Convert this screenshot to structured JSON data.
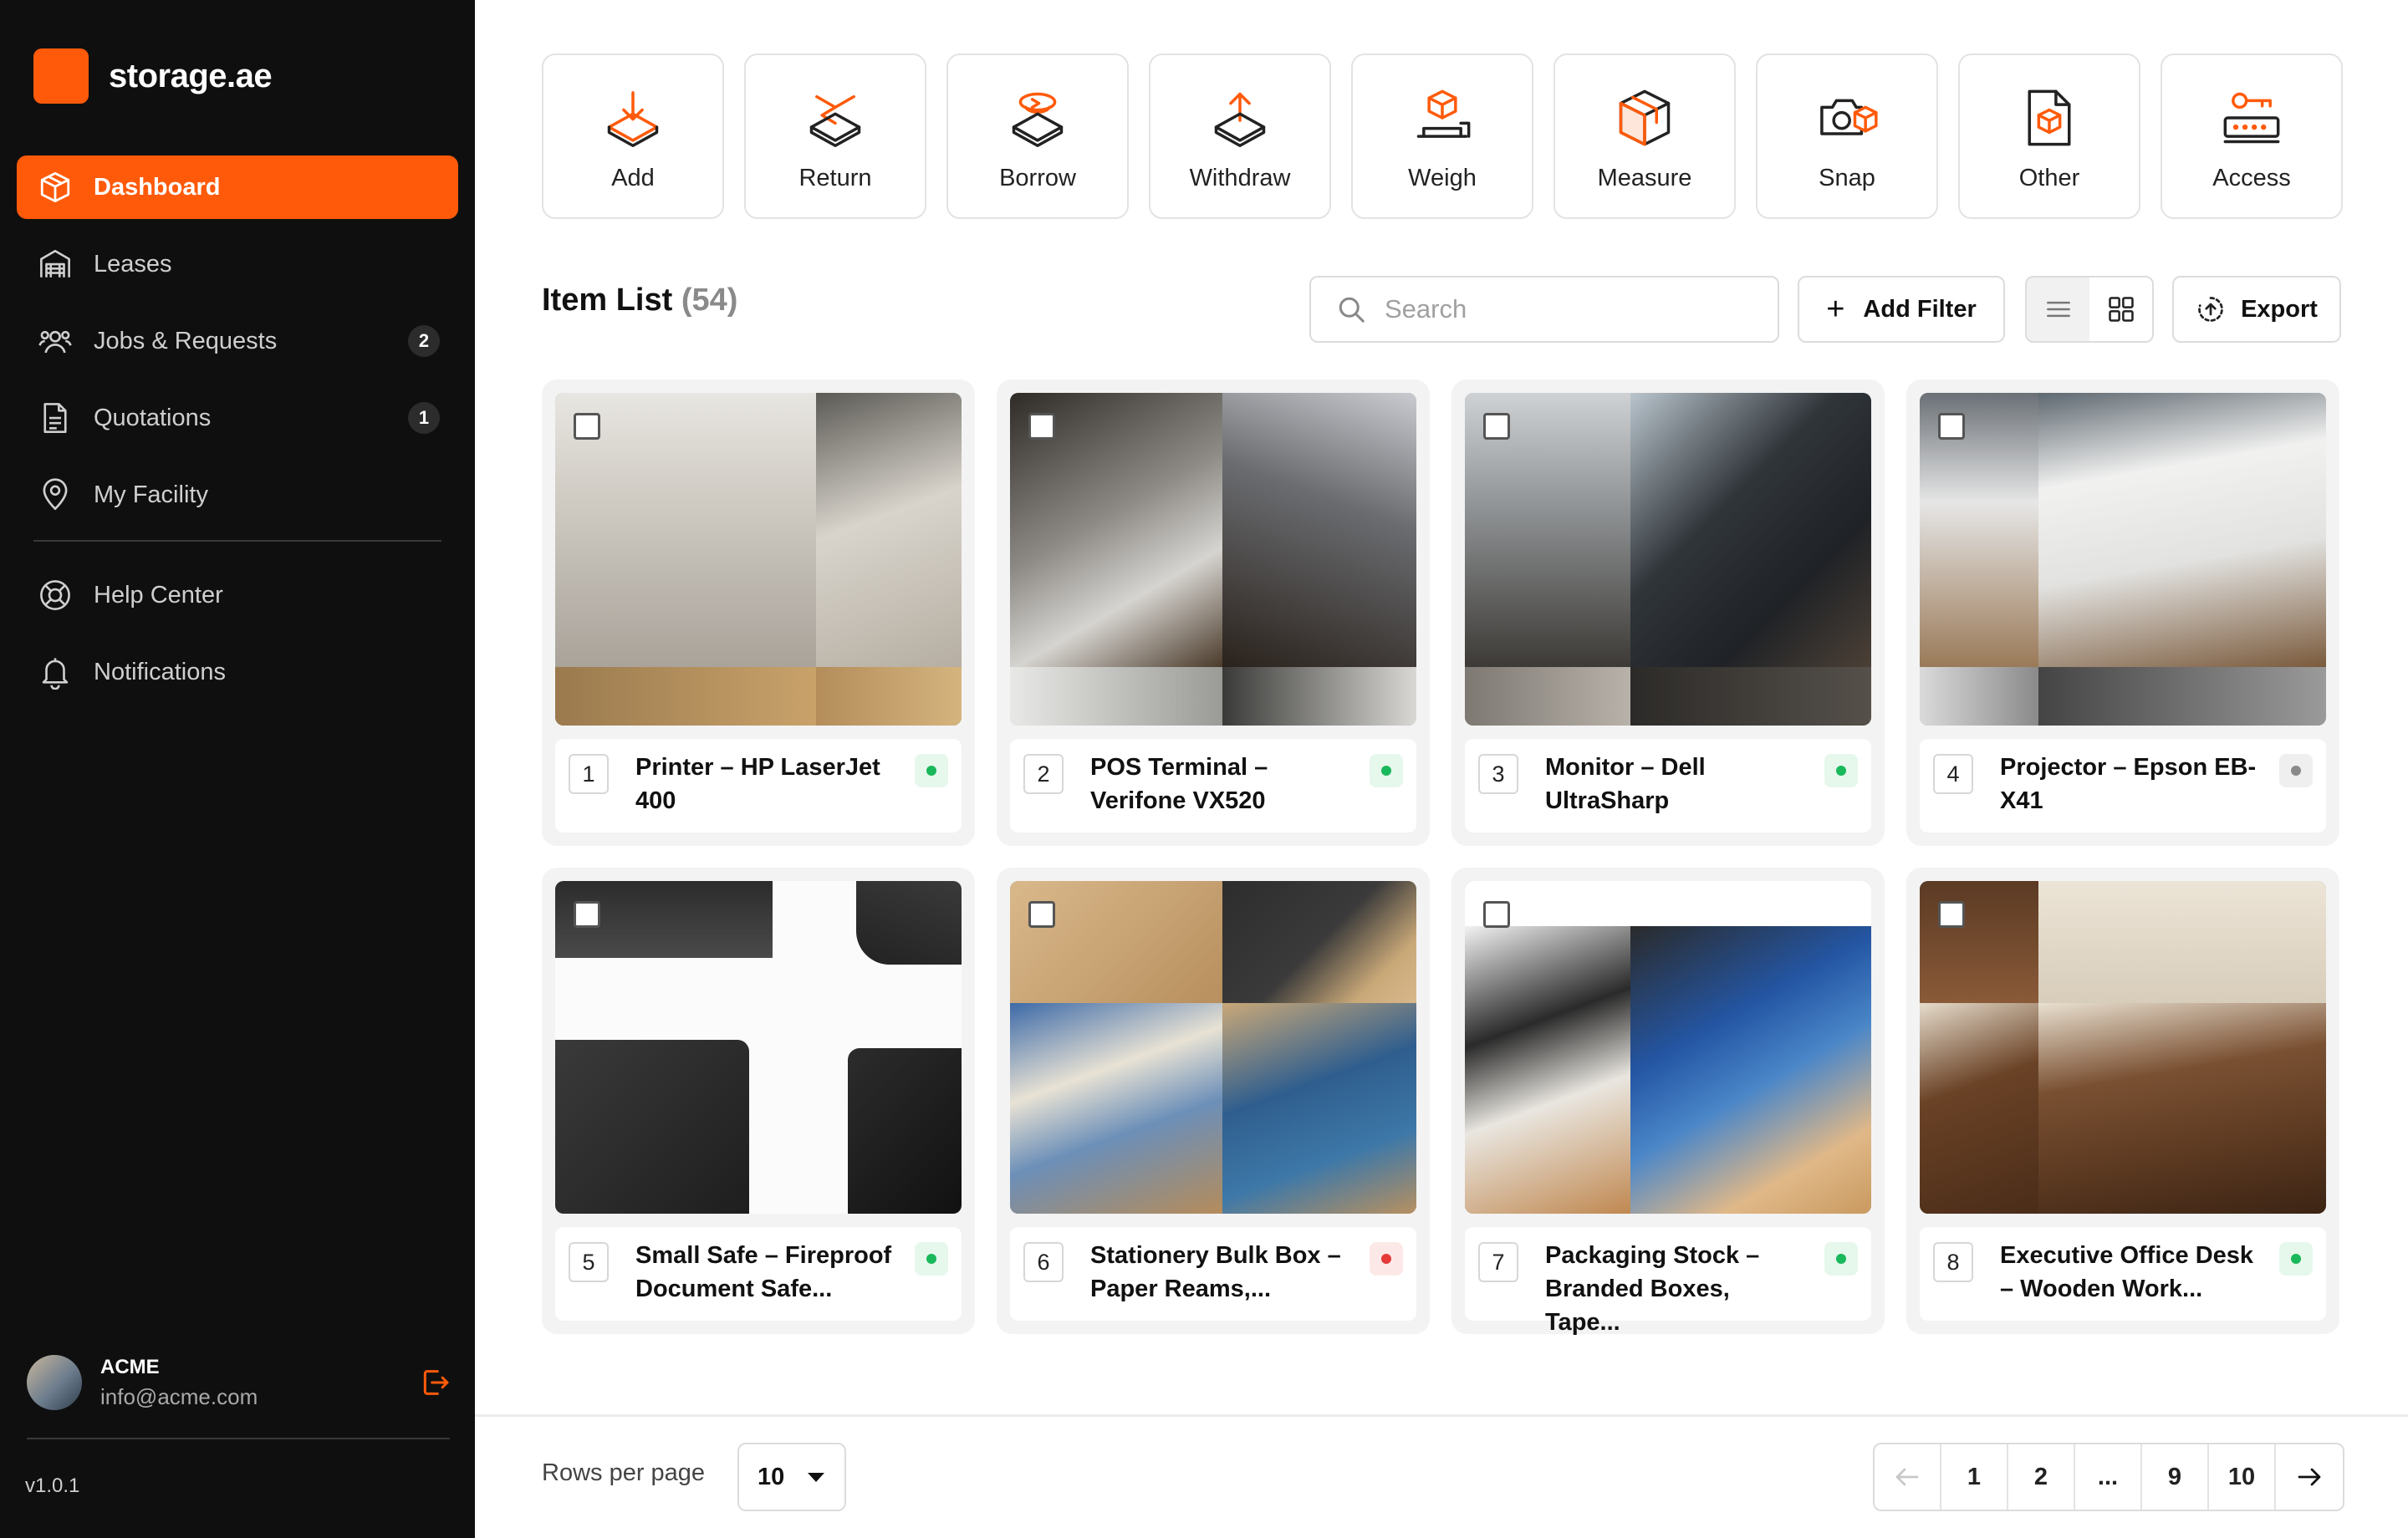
{
  "brand": {
    "name": "storage.ae",
    "accent": "#ff5a0a"
  },
  "sidebar": {
    "items": [
      {
        "label": "Dashboard",
        "icon": "box-icon",
        "active": true
      },
      {
        "label": "Leases",
        "icon": "warehouse-icon"
      },
      {
        "label": "Jobs & Requests",
        "icon": "users-icon",
        "badge": "2"
      },
      {
        "label": "Quotations",
        "icon": "document-icon",
        "badge": "1"
      },
      {
        "label": "My Facility",
        "icon": "location-pin-icon"
      }
    ],
    "secondary": [
      {
        "label": "Help Center",
        "icon": "lifebuoy-icon"
      },
      {
        "label": "Notifications",
        "icon": "bell-icon"
      }
    ],
    "user": {
      "name": "ACME",
      "email": "info@acme.com"
    },
    "version": "v1.0.1"
  },
  "actions": [
    {
      "label": "Add",
      "icon": "add-inbox-icon"
    },
    {
      "label": "Return",
      "icon": "return-icon"
    },
    {
      "label": "Borrow",
      "icon": "borrow-icon"
    },
    {
      "label": "Withdraw",
      "icon": "withdraw-icon"
    },
    {
      "label": "Weigh",
      "icon": "scale-icon"
    },
    {
      "label": "Measure",
      "icon": "cube-icon"
    },
    {
      "label": "Snap",
      "icon": "camera-icon"
    },
    {
      "label": "Other",
      "icon": "file-box-icon"
    },
    {
      "label": "Access",
      "icon": "key-icon"
    }
  ],
  "list": {
    "title": "Item List",
    "count": "(54)",
    "search_placeholder": "Search",
    "add_filter": "Add Filter",
    "export": "Export"
  },
  "items": [
    {
      "index": "1",
      "name": "Printer – HP LaserJet 400",
      "status": "green"
    },
    {
      "index": "2",
      "name": "POS Terminal – Verifone VX520",
      "status": "green"
    },
    {
      "index": "3",
      "name": "Monitor – Dell UltraSharp",
      "status": "green"
    },
    {
      "index": "4",
      "name": "Projector – Epson EB-X41",
      "status": "gray"
    },
    {
      "index": "5",
      "name": "Small Safe – Fireproof Document Safe...",
      "status": "green"
    },
    {
      "index": "6",
      "name": "Stationery Bulk Box – Paper Reams,...",
      "status": "red"
    },
    {
      "index": "7",
      "name": "Packaging Stock – Branded Boxes, Tape...",
      "status": "green"
    },
    {
      "index": "8",
      "name": "Executive Office Desk – Wooden Work...",
      "status": "green"
    }
  ],
  "pagination": {
    "rows_label": "Rows per page",
    "rows_value": "10",
    "pages": [
      "1",
      "2",
      "...",
      "9",
      "10"
    ],
    "current": "1"
  }
}
